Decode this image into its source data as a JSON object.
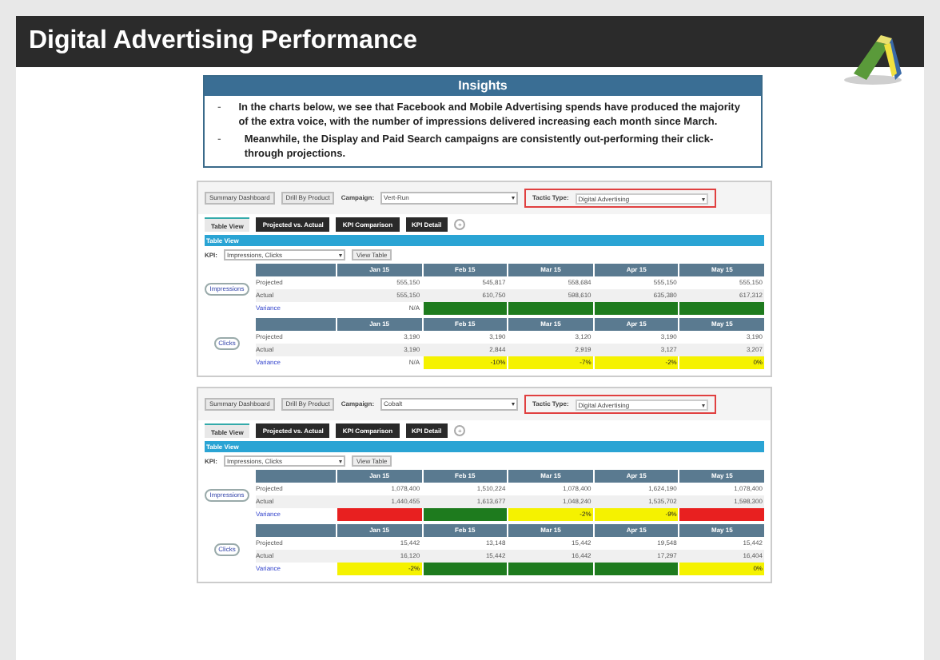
{
  "title": "Digital Advertising Performance",
  "insights": {
    "heading": "Insights",
    "bullet": "-",
    "points": [
      "In the charts below, we see that Facebook and Mobile Advertising spends have produced the majority of the extra voice, with the number of impressions delivered increasing each month since March.",
      "Meanwhile, the Display and Paid Search campaigns are consistently out-performing their click-through projections."
    ]
  },
  "panels": [
    {
      "buttons": [
        "Summary Dashboard",
        "Drill By Product"
      ],
      "campaign_label": "Campaign:",
      "campaign": "Vert-Run",
      "campaign_caret": "▾",
      "tactic_label": "Tactic Type:",
      "tactic": "Digital Advertising",
      "tactic_caret": "▾",
      "tactic_highlighted": true,
      "tabs": [
        {
          "label": "Table View",
          "selected": true
        },
        {
          "label": "Projected vs. Actual",
          "selected": false
        },
        {
          "label": "KPI Comparison",
          "selected": false
        },
        {
          "label": "KPI Detail",
          "selected": false
        }
      ],
      "add_tab": "+",
      "section_title": "Table View",
      "kpi_label": "KPI:",
      "kpi": "Impressions, Clicks",
      "kpi_caret": "▾",
      "view_button": "View Table",
      "groups": [
        {
          "metric": "Impressions",
          "months": [
            "Jan 15",
            "Feb 15",
            "Mar 15",
            "Apr 15",
            "May 15"
          ],
          "rows": [
            {
              "label": "Projected",
              "values": [
                "555,150",
                "545,817",
                "558,684",
                "555,150",
                "555,150"
              ]
            },
            {
              "label": "Actual",
              "values": [
                "555,150",
                "610,750",
                "598,610",
                "635,380",
                "617,312"
              ]
            }
          ],
          "variance_label": "Variance",
          "variance_first": "N/A",
          "variance": [
            {
              "color": "#1e7b1e"
            },
            {
              "color": "#1e7b1e"
            },
            {
              "color": "#1e7b1e"
            },
            {
              "color": "#1e7b1e"
            }
          ]
        },
        {
          "metric": "Clicks",
          "months": [
            "Jan 15",
            "Feb 15",
            "Mar 15",
            "Apr 15",
            "May 15"
          ],
          "rows": [
            {
              "label": "Projected",
              "values": [
                "3,190",
                "3,190",
                "3,120",
                "3,190",
                "3,190"
              ]
            },
            {
              "label": "Actual",
              "values": [
                "3,190",
                "2,844",
                "2,919",
                "3,127",
                "3,207"
              ]
            }
          ],
          "variance_label": "Variance",
          "variance_first": "N/A",
          "variance": [
            {
              "color": "#f5f200",
              "text": "-10%"
            },
            {
              "color": "#f5f200",
              "text": "-7%"
            },
            {
              "color": "#f5f200",
              "text": "-2%"
            },
            {
              "color": "#f5f200",
              "text": "0%"
            }
          ]
        }
      ]
    },
    {
      "buttons": [
        "Summary Dashboard",
        "Drill By Product"
      ],
      "campaign_label": "Campaign:",
      "campaign": "Cobalt",
      "campaign_caret": "▾",
      "tactic_label": "Tactic Type:",
      "tactic": "Digital Advertising",
      "tactic_caret": "▾",
      "tactic_highlighted": true,
      "tabs": [
        {
          "label": "Table View",
          "selected": true
        },
        {
          "label": "Projected vs. Actual",
          "selected": false
        },
        {
          "label": "KPI Comparison",
          "selected": false
        },
        {
          "label": "KPI Detail",
          "selected": false
        }
      ],
      "add_tab": "+",
      "section_title": "Table View",
      "kpi_label": "KPI:",
      "kpi": "Impressions, Clicks",
      "kpi_caret": "▾",
      "view_button": "View Table",
      "groups": [
        {
          "metric": "Impressions",
          "months": [
            "Jan 15",
            "Feb 15",
            "Mar 15",
            "Apr 15",
            "May 15"
          ],
          "rows": [
            {
              "label": "Projected",
              "values": [
                "1,078,400",
                "1,510,224",
                "1,078,400",
                "1,624,190",
                "1,078,400"
              ]
            },
            {
              "label": "Actual",
              "values": [
                "1,440,455",
                "1,613,677",
                "1,048,240",
                "1,535,702",
                "1,598,300"
              ]
            }
          ],
          "variance_label": "Variance",
          "variance": [
            {
              "color": "#e82020"
            },
            {
              "color": "#1e7b1e"
            },
            {
              "color": "#f5f200",
              "text": "-2%"
            },
            {
              "color": "#f5f200",
              "text": "-9%"
            },
            {
              "color": "#e82020"
            }
          ]
        },
        {
          "metric": "Clicks",
          "months": [
            "Jan 15",
            "Feb 15",
            "Mar 15",
            "Apr 15",
            "May 15"
          ],
          "rows": [
            {
              "label": "Projected",
              "values": [
                "15,442",
                "13,148",
                "15,442",
                "19,548",
                "15,442"
              ]
            },
            {
              "label": "Actual",
              "values": [
                "16,120",
                "15,442",
                "16,442",
                "17,297",
                "16,404"
              ]
            }
          ],
          "variance_label": "Variance",
          "variance": [
            {
              "color": "#f5f200",
              "text": "-2%"
            },
            {
              "color": "#1e7b1e"
            },
            {
              "color": "#1e7b1e"
            },
            {
              "color": "#1e7b1e"
            },
            {
              "color": "#f5f200",
              "text": "0%"
            }
          ]
        }
      ]
    }
  ]
}
